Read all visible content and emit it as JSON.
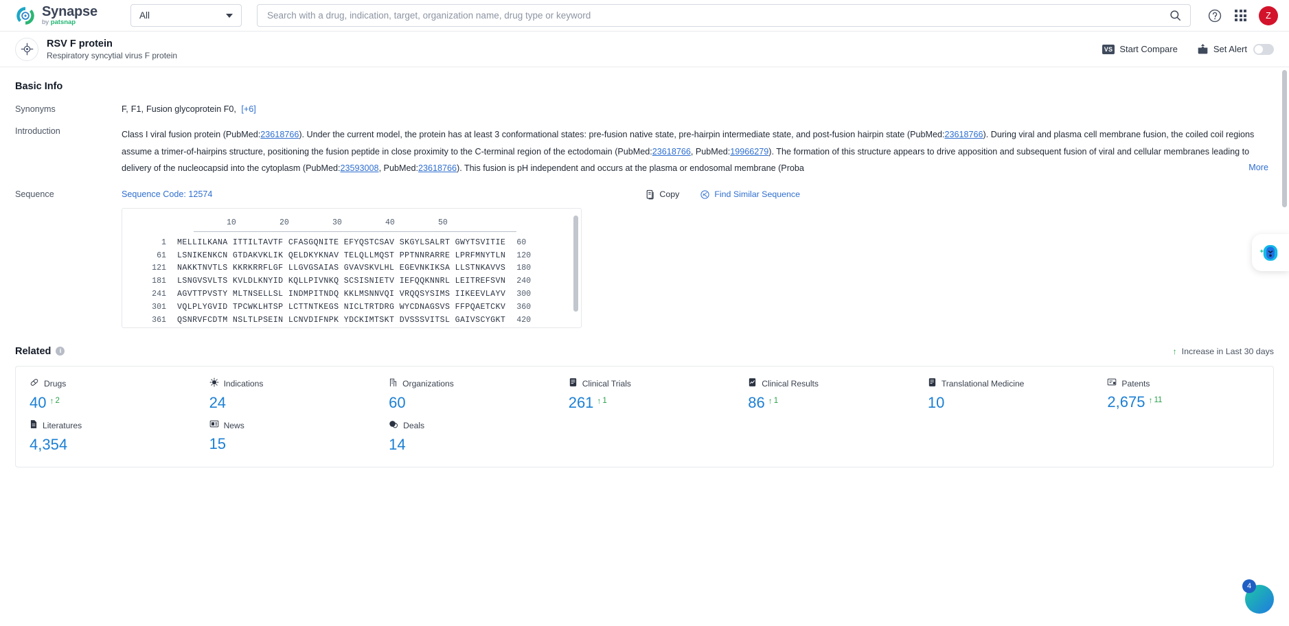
{
  "header": {
    "logo_name": "Synapse",
    "logo_sub_prefix": "by ",
    "logo_sub_brand": "patsnap",
    "scope_value": "All",
    "search_placeholder": "Search with a drug, indication, target, organization name, drug type or keyword",
    "search_value": "",
    "help_icon": "question-circle-icon",
    "apps_icon": "grid-apps-icon",
    "avatar_initial": "Z"
  },
  "titlebar": {
    "icon": "target-icon",
    "title": "RSV F protein",
    "subtitle": "Respiratory syncytial virus F protein",
    "compare_badge": "VS",
    "compare_label": "Start Compare",
    "alert_icon": "bell-upload-icon",
    "alert_label": "Set Alert",
    "alert_toggle_on": false
  },
  "basic_info": {
    "section_title": "Basic Info",
    "synonyms_label": "Synonyms",
    "synonyms": [
      "F,",
      "F1,",
      "Fusion glycoprotein F0,"
    ],
    "synonyms_more": "[+6]",
    "introduction_label": "Introduction",
    "introduction_more": "More",
    "introduction_parts": [
      {
        "t": "Class I viral fusion protein (PubMed:",
        "k": "txt"
      },
      {
        "t": "23618766",
        "k": "link"
      },
      {
        "t": "). Under the current model, the protein has at least 3 conformational states: pre-fusion native state, pre-hairpin intermediate state, and post-fusion hairpin state (PubMed:",
        "k": "txt"
      },
      {
        "t": "23618766",
        "k": "link"
      },
      {
        "t": "). During viral and plasma cell membrane fusion, the coiled coil regions assume a trimer-of-hairpins structure, positioning the fusion peptide in close proximity to the C-terminal region of the ectodomain (PubMed:",
        "k": "txt"
      },
      {
        "t": "23618766",
        "k": "link"
      },
      {
        "t": ", PubMed:",
        "k": "txt"
      },
      {
        "t": "19966279",
        "k": "link"
      },
      {
        "t": "). The formation of this structure appears to drive apposition and subsequent fusion of viral and cellular membranes leading to delivery of the nucleocapsid into the cytoplasm (PubMed:",
        "k": "txt"
      },
      {
        "t": "23593008",
        "k": "link"
      },
      {
        "t": ", PubMed:",
        "k": "txt"
      },
      {
        "t": "23618766",
        "k": "link"
      },
      {
        "t": "). This fusion is pH independent and occurs at the plasma or endosomal membrane (Proba",
        "k": "txt"
      }
    ]
  },
  "sequence": {
    "label": "Sequence",
    "code_label": "Sequence Code: 12574",
    "copy_icon": "copy-icon",
    "copy_label": "Copy",
    "find_icon": "find-similar-icon",
    "find_label": "Find Similar Sequence",
    "ruler_ticks": [
      "10",
      "20",
      "30",
      "40",
      "50"
    ],
    "rows": [
      {
        "start": "1",
        "chunks": "MELLILKANA ITTILTAVTF CFASGQNITE EFYQSTCSAV SKGYLSALRT GWYTSVITIE",
        "end": "60"
      },
      {
        "start": "61",
        "chunks": "LSNIKENKCN GTDAKVKLIK QELDKYKNAV TELQLLMQST PPTNNRARRE LPRFMNYTLN",
        "end": "120"
      },
      {
        "start": "121",
        "chunks": "NAKKTNVTLS KKRKRRFLGF LLGVGSAIAS GVAVSKVLHL EGEVNKIKSA LLSTNKAVVS",
        "end": "180"
      },
      {
        "start": "181",
        "chunks": "LSNGVSVLTS KVLDLKNYID KQLLPIVNKQ SCSISNIETV IEFQQKNNRL LEITREFSVN",
        "end": "240"
      },
      {
        "start": "241",
        "chunks": "AGVTTPVSTY MLTNSELLSL INDMPITNDQ KKLMSNNVQI VRQQSYSIMS IIKEEVLAYV",
        "end": "300"
      },
      {
        "start": "301",
        "chunks": "VQLPLYGVID TPCWKLHTSP LCTTNTKEGS NICLTRTDRG WYCDNAGSVS FFPQAETCKV",
        "end": "360"
      },
      {
        "start": "361",
        "chunks": "QSNRVFCDTM NSLTLPSEIN LCNVDIFNPK YDCKIMTSKT DVSSSVITSL GAIVSCYGKT",
        "end": "420"
      }
    ]
  },
  "related": {
    "title": "Related",
    "info_icon": "info-icon",
    "legend_arrow": "up-arrow-icon",
    "legend_label": "Increase in Last 30 days",
    "stats": [
      {
        "icon": "pill-icon",
        "label": "Drugs",
        "value": "40",
        "delta": "2"
      },
      {
        "icon": "virus-icon",
        "label": "Indications",
        "value": "24",
        "delta": ""
      },
      {
        "icon": "building-icon",
        "label": "Organizations",
        "value": "60",
        "delta": ""
      },
      {
        "icon": "clinical-trial-icon",
        "label": "Clinical Trials",
        "value": "261",
        "delta": "1"
      },
      {
        "icon": "clinical-result-icon",
        "label": "Clinical Results",
        "value": "86",
        "delta": "1"
      },
      {
        "icon": "translational-icon",
        "label": "Translational Medicine",
        "value": "10",
        "delta": ""
      },
      {
        "icon": "patent-icon",
        "label": "Patents",
        "value": "2,675",
        "delta": "11"
      },
      {
        "icon": "literature-icon",
        "label": "Literatures",
        "value": "4,354",
        "delta": ""
      },
      {
        "icon": "news-icon",
        "label": "News",
        "value": "15",
        "delta": ""
      },
      {
        "icon": "deal-icon",
        "label": "Deals",
        "value": "14",
        "delta": ""
      }
    ]
  },
  "floating": {
    "ai_icon": "ai-assistant-icon",
    "fab_icon": "chat-fab-icon",
    "fab_badge": "4"
  },
  "colors": {
    "accent_blue": "#1b7fd4",
    "link_blue": "#2f6fd0",
    "increase_green": "#2aa14b",
    "avatar_red": "#d3132b"
  }
}
